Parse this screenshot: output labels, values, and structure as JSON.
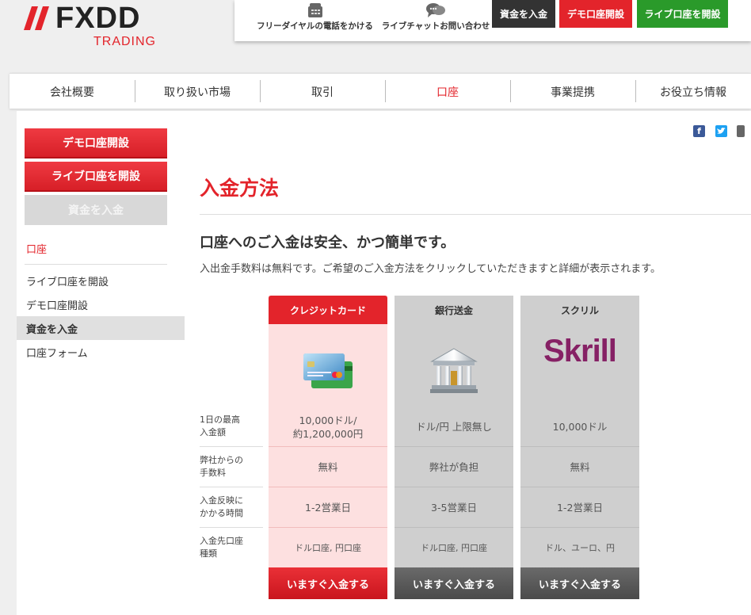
{
  "brand": {
    "name": "FXDD",
    "sub": "TRADING",
    "accent": "#e3242b"
  },
  "topbar": {
    "phone_label": "フリーダイヤルの電話をかける",
    "chat_label": "ライブチャットお問い合わせ",
    "deposit_btn": "資金を入金",
    "demo_btn": "デモ口座開設",
    "live_btn": "ライブ口座を開設"
  },
  "nav": {
    "items": [
      "会社概要",
      "取り扱い市場",
      "取引",
      "口座",
      "事業提携",
      "お役立ち情報"
    ],
    "active_index": 3
  },
  "sidebar": {
    "demo_btn": "デモ口座開設",
    "live_btn": "ライブ口座を開設",
    "deposit_btn": "資金を入金",
    "section": "口座",
    "links": [
      "ライブ口座を開設",
      "デモ口座開設",
      "資金を入金",
      "口座フォーム"
    ],
    "active_link": 2
  },
  "main": {
    "title": "入金方法",
    "subheading": "口座へのご入金は安全、かつ簡単です。",
    "description": "入出金手数料は無料です。ご希望のご入金方法をクリックしていただきますと詳細が表示されます。",
    "row_labels": [
      [
        "1日の最高",
        "入金額"
      ],
      [
        "弊社からの",
        "手数料"
      ],
      [
        "入金反映に",
        "かかる時間"
      ],
      [
        "入金先口座",
        "種類"
      ]
    ],
    "methods": [
      {
        "name": "クレジットカード",
        "icon": "credit-card-icon",
        "limit": [
          "10,000ドル/",
          "約1,200,000円"
        ],
        "fee": "無料",
        "time": "1-2営業日",
        "accounts": "ドル口座, 円口座",
        "cta": "いますぐ入金する"
      },
      {
        "name": "銀行送金",
        "icon": "bank-icon",
        "limit": [
          "ドル/円 上限無し"
        ],
        "fee": "弊社が負担",
        "time": "3-5営業日",
        "accounts": "ドル口座, 円口座",
        "cta": "いますぐ入金する"
      },
      {
        "name": "スクリル",
        "icon": "skrill-logo",
        "logo_text": "Skrill",
        "limit": [
          "10,000ドル"
        ],
        "fee": "無料",
        "time": "1-2営業日",
        "accounts": "ドル、ユーロ、円",
        "cta": "いますぐ入金する"
      }
    ]
  },
  "colors": {
    "red": "#e3242b",
    "green": "#2a9a2a",
    "dark": "#333333",
    "skrill": "#862165",
    "facebook": "#3b5998",
    "twitter": "#1da1f2"
  }
}
